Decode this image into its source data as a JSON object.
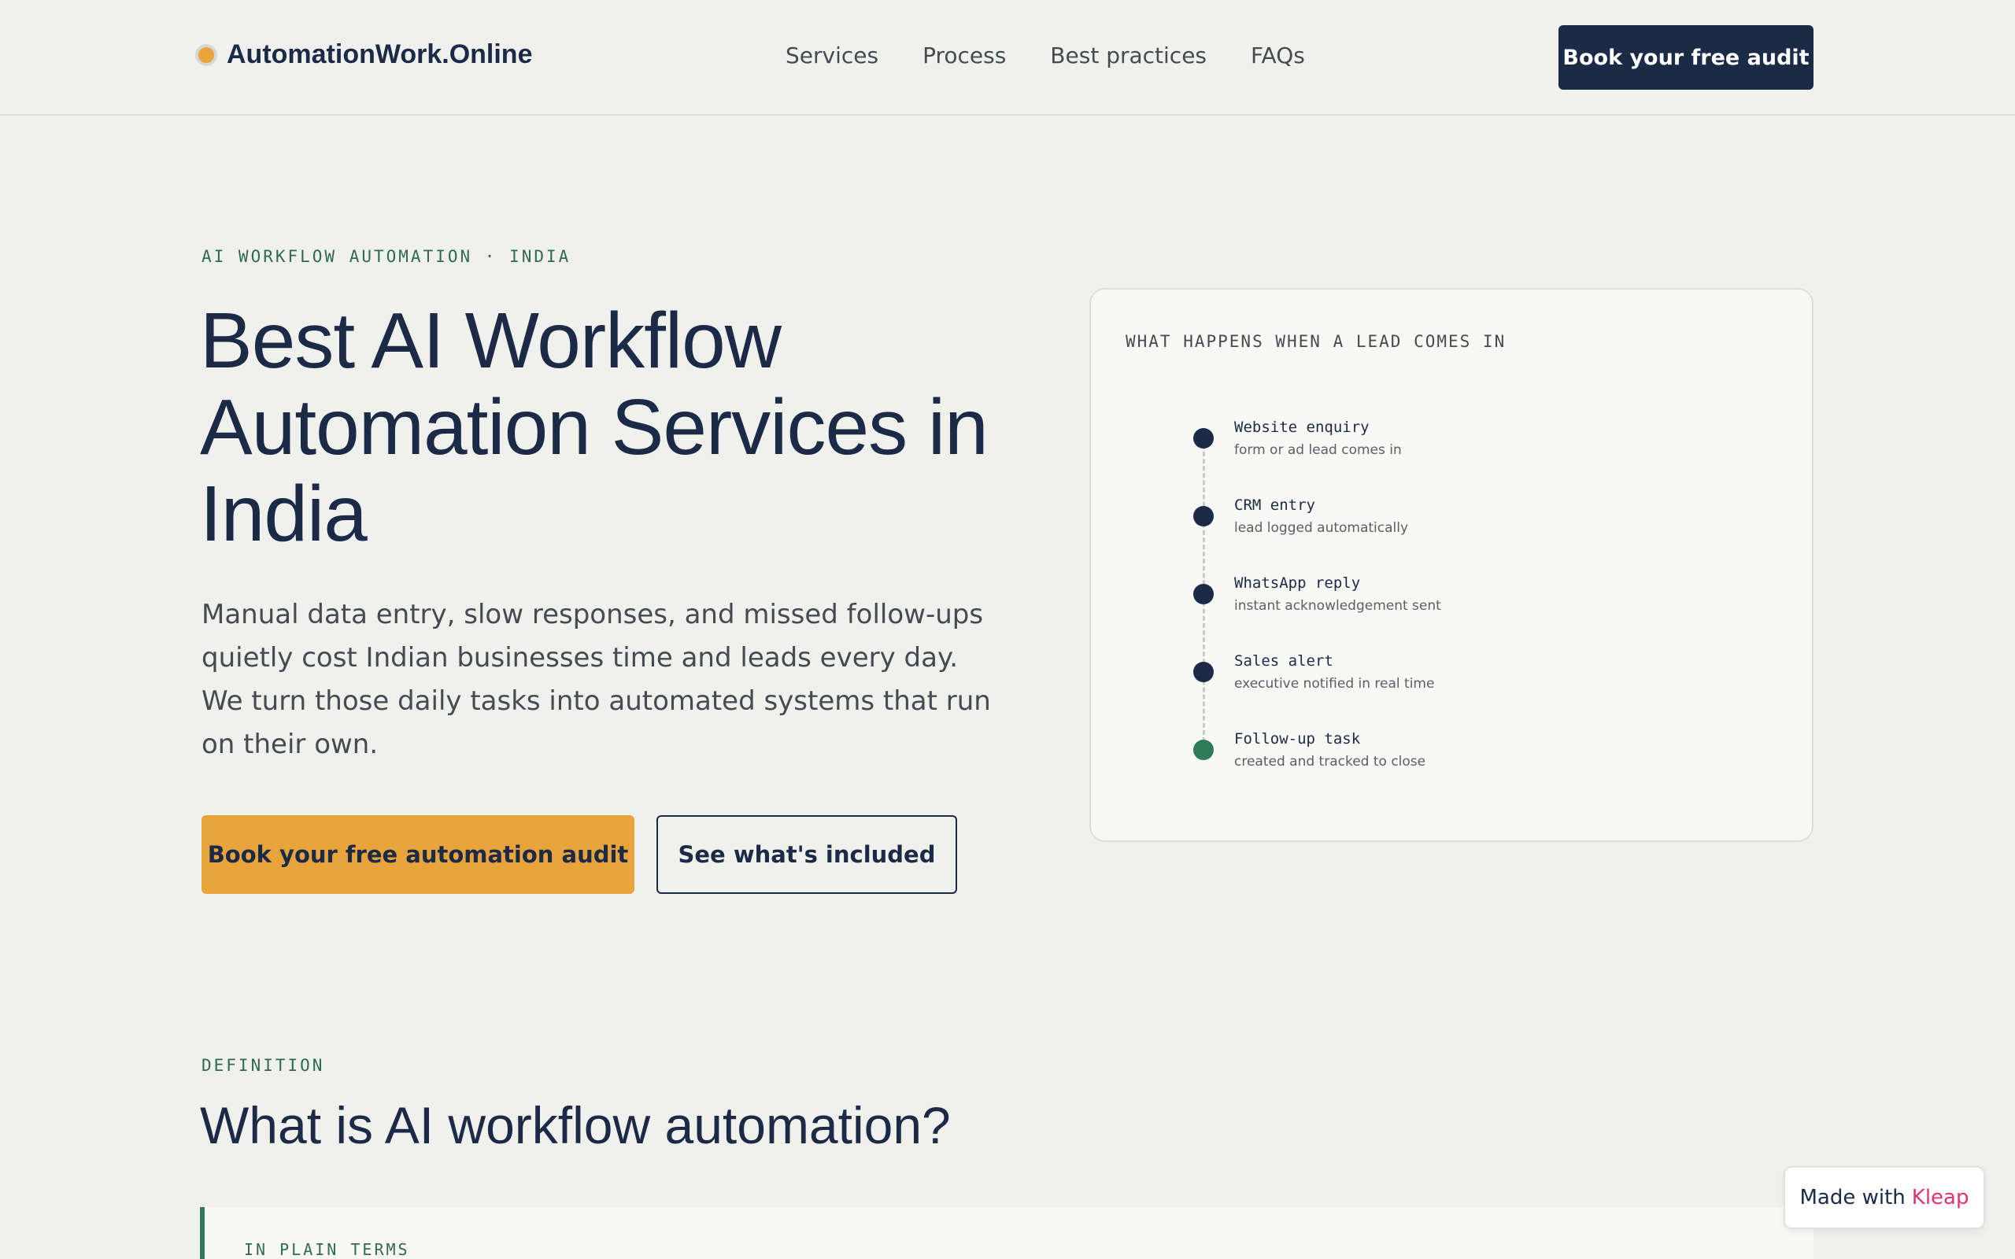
{
  "nav": {
    "brand": "AutomationWork.Online",
    "links": [
      "Services",
      "Process",
      "Best practices",
      "FAQs"
    ],
    "cta": "Book your free audit"
  },
  "hero": {
    "eyebrow": "AI WORKFLOW AUTOMATION · INDIA",
    "title": "Best AI Workflow Automation Services in India",
    "text": "Manual data entry, slow responses, and missed follow-ups quietly cost Indian businesses time and leads every day. We turn those daily tasks into automated systems that run on their own.",
    "primary_cta": "Book your free automation audit",
    "secondary_cta": "See what's included"
  },
  "card": {
    "title": "WHAT HAPPENS WHEN A LEAD COMES IN",
    "steps": [
      {
        "label": "Website enquiry",
        "sub": "form or ad lead comes in",
        "status": "active"
      },
      {
        "label": "CRM entry",
        "sub": "lead logged automatically",
        "status": "active"
      },
      {
        "label": "WhatsApp reply",
        "sub": "instant acknowledgement sent",
        "status": "active"
      },
      {
        "label": "Sales alert",
        "sub": "executive notified in real time",
        "status": "active"
      },
      {
        "label": "Follow-up task",
        "sub": "created and tracked to close",
        "status": "done"
      }
    ]
  },
  "definition": {
    "eyebrow": "DEFINITION",
    "title": "What is AI workflow automation?",
    "plain_label": "IN PLAIN TERMS"
  },
  "badge": {
    "prefix": "Made with",
    "brand": "Kleap"
  },
  "colors": {
    "navy": "#1b2a47",
    "accent": "#e8a33a",
    "green": "#2f7a57",
    "background": "#f0f1ec",
    "kleap_pink": "#e5316c"
  }
}
